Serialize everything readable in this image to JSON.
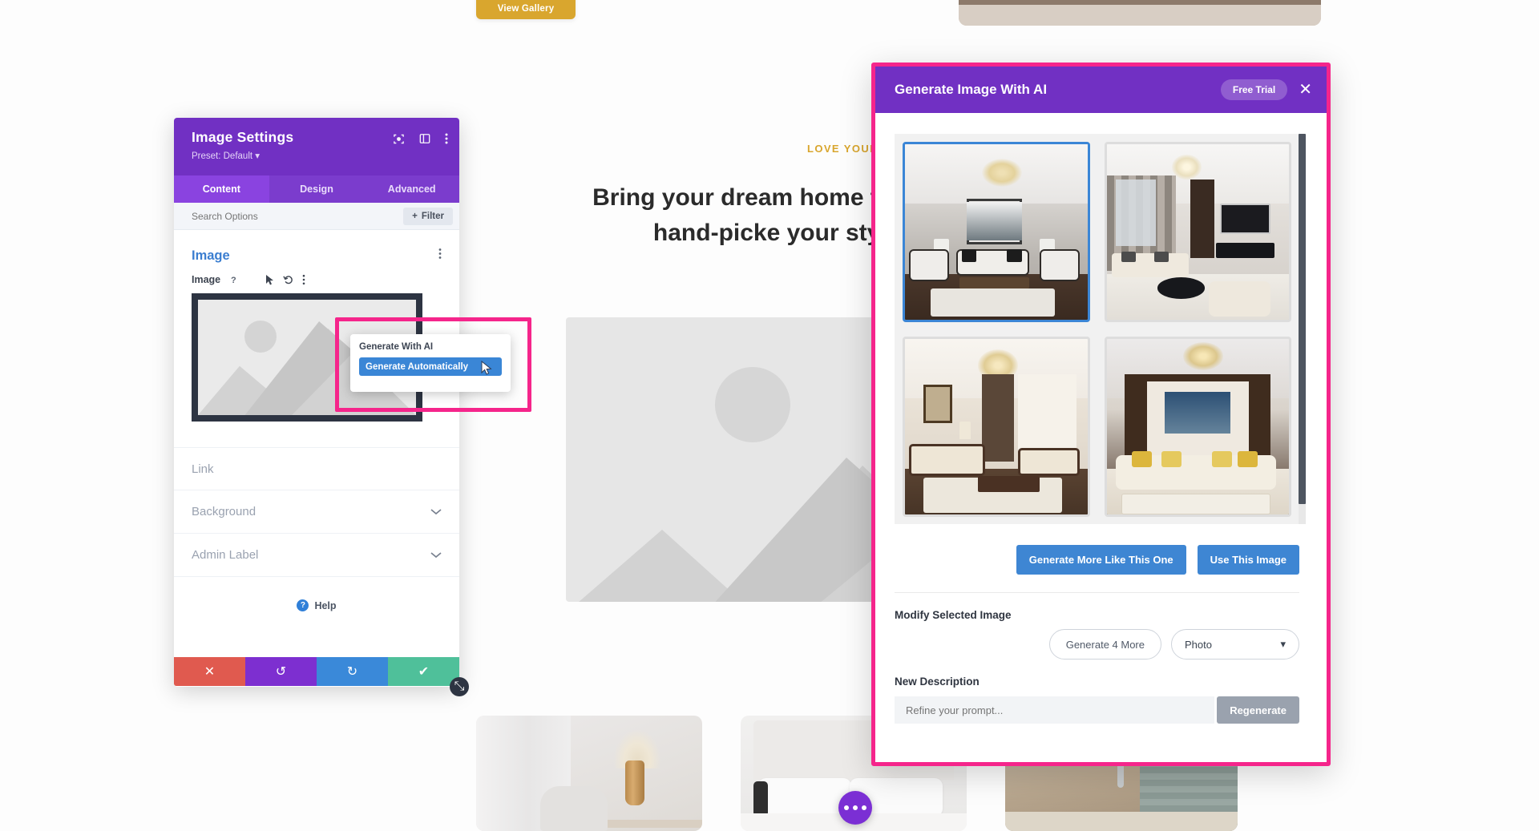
{
  "background_site": {
    "view_gallery_label": "View Gallery",
    "eyebrow": "LOVE YOUR S",
    "headline": "Bring your dream home t design help & hand-picke your style, space"
  },
  "settings_panel": {
    "title": "Image Settings",
    "preset": "Preset: Default",
    "preset_caret": "▾",
    "header_icons": [
      {
        "name": "target-icon",
        "glyph": "◎"
      },
      {
        "name": "layout-panel-icon",
        "glyph": "▧"
      },
      {
        "name": "more-vertical-icon",
        "glyph": "⋮"
      }
    ],
    "tabs": [
      {
        "label": "Content",
        "active": true
      },
      {
        "label": "Design",
        "active": false
      },
      {
        "label": "Advanced",
        "active": false
      }
    ],
    "search_placeholder": "Search Options",
    "filter_label": "Filter",
    "filter_plus": "+",
    "group": {
      "title": "Image",
      "collapse_icon": "˄",
      "menu_icon": "⋮"
    },
    "field": {
      "label": "Image",
      "icons": [
        "?",
        "📱",
        "➤",
        "↺",
        "⋮"
      ]
    },
    "accordions": [
      {
        "label": "Link",
        "chevron": "˅"
      },
      {
        "label": "Background",
        "chevron": "˅"
      },
      {
        "label": "Admin Label",
        "chevron": "˅"
      }
    ],
    "help_label": "Help",
    "help_badge": "?",
    "footer_buttons": [
      {
        "name": "cancel-button",
        "glyph": "✕",
        "color": "#e05a4f"
      },
      {
        "name": "undo-button",
        "glyph": "↺",
        "color": "#7d2fd0"
      },
      {
        "name": "redo-button",
        "glyph": "↻",
        "color": "#3a89d9"
      },
      {
        "name": "save-button",
        "glyph": "✔",
        "color": "#4fc09a"
      }
    ],
    "resize_handle_glyph": "⤡"
  },
  "ai_popup": {
    "label": "Generate With AI",
    "button_label": "Generate Automatically"
  },
  "ai_modal": {
    "title": "Generate Image With AI",
    "free_trial_badge": "Free Trial",
    "close_glyph": "✕",
    "thumbnails": [
      {
        "alt": "Gray panelled living room with crystal chandelier, white sofas and dark wood floor",
        "selected": true
      },
      {
        "alt": "Modern beige living room with wall mounted TV and grey curtains",
        "selected": false
      },
      {
        "alt": "Classic living room with carved wood sofas, framed art and gold chandelier",
        "selected": false
      },
      {
        "alt": "Dark wood living room with gold pillows, tufted sofa and large TV",
        "selected": false
      }
    ],
    "actions": [
      {
        "name": "generate-more-like-this-button",
        "label": "Generate More Like This One"
      },
      {
        "name": "use-this-image-button",
        "label": "Use This Image"
      }
    ],
    "modify_section_label": "Modify Selected Image",
    "generate_more_label": "Generate 4 More",
    "style_select": {
      "value": "Photo",
      "caret": "▾"
    },
    "new_description_label": "New Description",
    "prompt_placeholder": "Refine your prompt...",
    "regenerate_label": "Regenerate"
  },
  "fab": {
    "name": "divi-menu-fab",
    "dots": 3
  },
  "colors": {
    "divi_purple": "#7130c3",
    "tab_purple": "#8a43e0",
    "highlight_pink": "#f5258b",
    "accent_blue": "#3e86d3",
    "gold": "#d9a62e"
  }
}
